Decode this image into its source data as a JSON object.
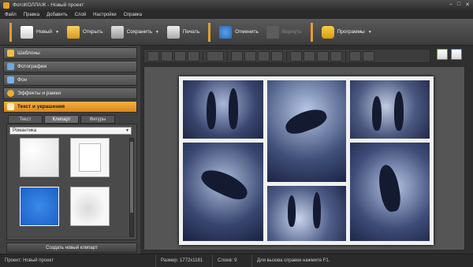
{
  "window": {
    "title": "ФотоКОЛЛАЖ - Новый проект",
    "controls": [
      "–",
      "□",
      "✕"
    ]
  },
  "menu": [
    "Файл",
    "Правка",
    "Добавить",
    "Слой",
    "Настройки",
    "Справка"
  ],
  "toolbar": {
    "new_label": "Новый",
    "open_label": "Открыть",
    "save_label": "Сохранить",
    "print_label": "Печать",
    "undo_label": "Отменить",
    "redo_label": "Вернуть",
    "programs_label": "Программы",
    "accent_color": "#e0a030"
  },
  "sections": [
    {
      "label": "Шаблоны",
      "icon": "template-icon"
    },
    {
      "label": "Фотографии",
      "icon": "photos-icon"
    },
    {
      "label": "Фон",
      "icon": "background-icon"
    },
    {
      "label": "Эффекты и рамки",
      "icon": "effects-icon"
    },
    {
      "label": "Текст и украшения",
      "icon": "text-icon",
      "active": true
    }
  ],
  "subtabs": [
    "Текст",
    "Клипарт",
    "Фигуры"
  ],
  "clipart": {
    "category": "Романтика",
    "create_button": "Создать новый клипарт"
  },
  "status": {
    "project": "Проект:   Новый проект",
    "size": "Размер:   1772x1181",
    "layers": "Слоев:   9",
    "help": "Для вызова справки нажмите F1."
  }
}
